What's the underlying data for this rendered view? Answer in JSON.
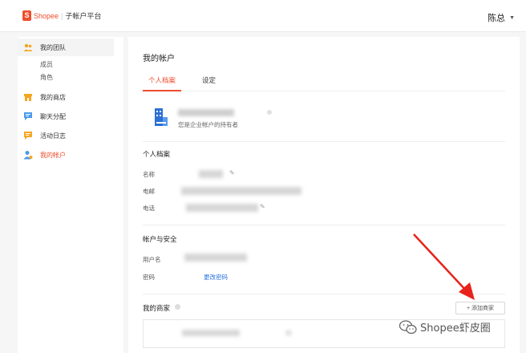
{
  "header": {
    "brand": "Shopee",
    "separator": "|",
    "platform": "子帐户平台",
    "user_name": "陈总",
    "caret": "▼"
  },
  "sidebar": {
    "items": [
      {
        "label": "我的团队",
        "icon": "team-icon"
      },
      {
        "label": "成员"
      },
      {
        "label": "角色"
      },
      {
        "label": "我的商店",
        "icon": "shop-icon"
      },
      {
        "label": "聊天分配",
        "icon": "chat-icon"
      },
      {
        "label": "活动日志",
        "icon": "log-icon"
      },
      {
        "label": "我的帐户",
        "icon": "account-icon"
      }
    ]
  },
  "main": {
    "title": "我的帐户",
    "tabs": [
      {
        "label": "个人档案",
        "active": true
      },
      {
        "label": "设定",
        "active": false
      }
    ],
    "owner": {
      "description": "您是企业帐户的持有者"
    },
    "profile": {
      "section_title": "个人档案",
      "fields": [
        {
          "label": "名称"
        },
        {
          "label": "电邮"
        },
        {
          "label": "电话"
        }
      ]
    },
    "security": {
      "section_title": "帐户与安全",
      "username_label": "用户名",
      "password_label": "密码",
      "change_password": "更改密码"
    },
    "merchants": {
      "section_title": "我的商家",
      "add_button": "+ 添加商家"
    }
  },
  "watermark": {
    "text": "Shopee虾皮圈"
  },
  "colors": {
    "accent": "#ee4d2d",
    "link": "#2673dd",
    "arrow": "#e8231b"
  }
}
